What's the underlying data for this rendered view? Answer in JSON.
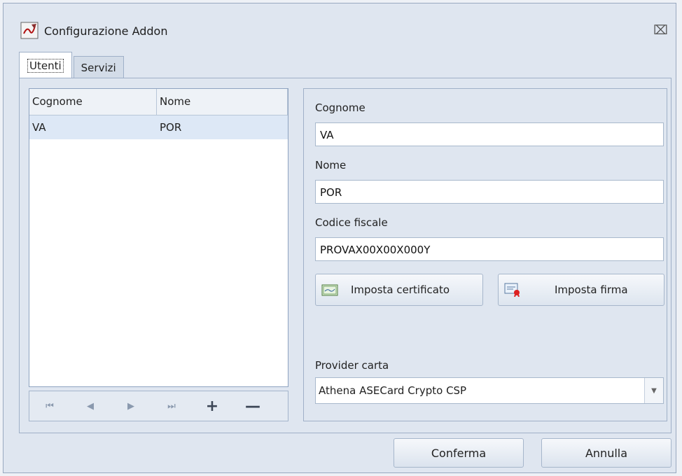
{
  "window": {
    "title": "Configurazione Addon",
    "close_symbol": "⌧"
  },
  "tabs": [
    {
      "label": "Utenti"
    },
    {
      "label": "Servizi"
    }
  ],
  "grid": {
    "columns": [
      "Cognome",
      "Nome"
    ],
    "rows": [
      {
        "cognome": "VA",
        "nome": "POR"
      }
    ]
  },
  "navigator": {
    "first": "⏮",
    "prev": "◀",
    "next": "▶",
    "last": "⏭",
    "add": "+",
    "remove": "—"
  },
  "detail": {
    "cognome_label": "Cognome",
    "cognome_value": "VA",
    "nome_label": "Nome",
    "nome_value": "POR",
    "cf_label": "Codice fiscale",
    "cf_value": "PROVAX00X00X000Y",
    "cert_button": "Imposta certificato",
    "sign_button": "Imposta firma",
    "provider_label": "Provider carta",
    "provider_value": "Athena ASECard Crypto CSP"
  },
  "footer": {
    "confirm": "Conferma",
    "cancel": "Annulla"
  },
  "icons": {
    "app": "app-icon",
    "certificate": "certificate-icon",
    "signature": "signature-icon"
  }
}
